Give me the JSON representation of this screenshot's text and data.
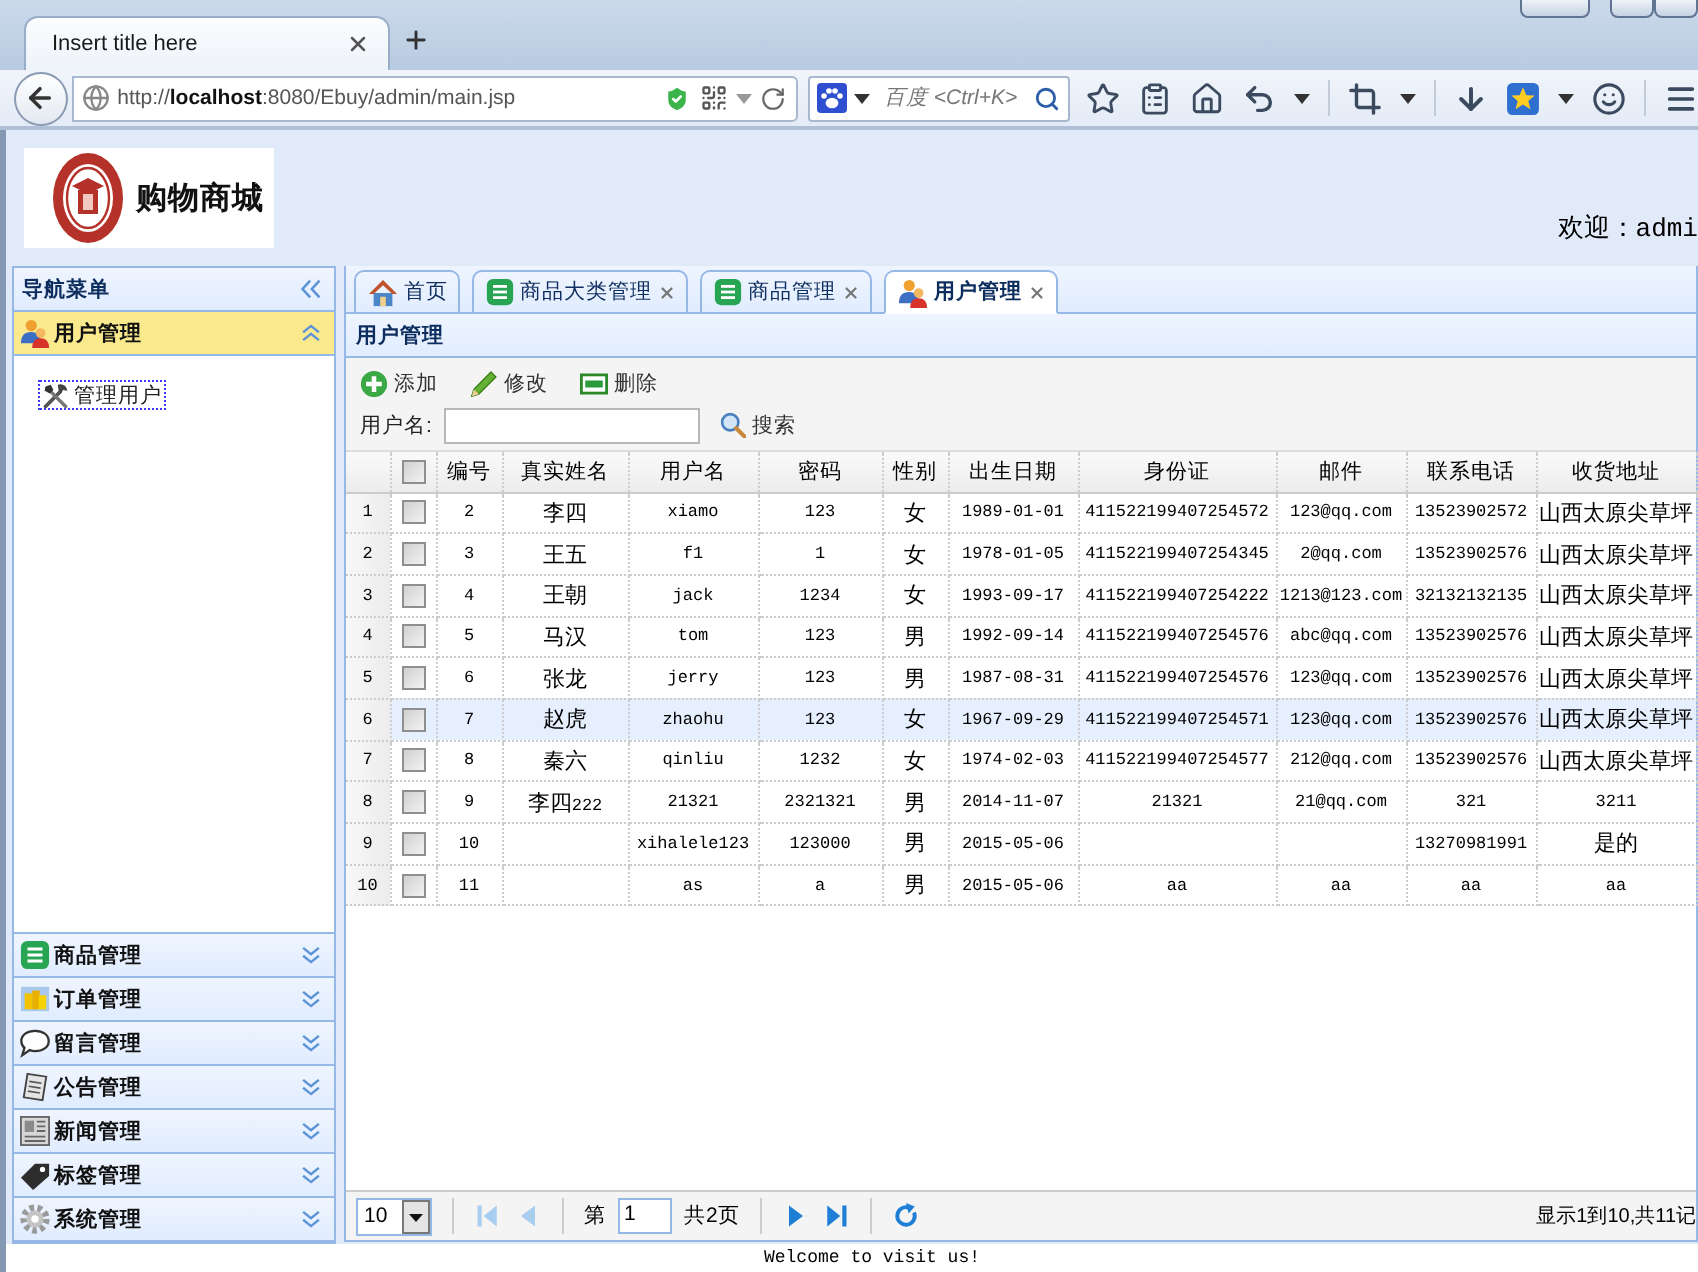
{
  "browser": {
    "tab_title": "Insert title here",
    "url": "http://**localhost**:8080/Ebuy/admin/main.jsp",
    "search_placeholder": "百度 <Ctrl+K>"
  },
  "header": {
    "logo_text": "购物商城",
    "welcome": "欢迎：admi"
  },
  "sidebar": {
    "title": "导航菜单",
    "sections": [
      {
        "kind": "user",
        "label": "用户管理",
        "expanded": true,
        "items": [
          {
            "label": "管理用户",
            "selected": true
          }
        ]
      },
      {
        "kind": "product",
        "label": "商品管理",
        "expanded": false
      },
      {
        "kind": "order",
        "label": "订单管理",
        "expanded": false
      },
      {
        "kind": "message",
        "label": "留言管理",
        "expanded": false
      },
      {
        "kind": "notice",
        "label": "公告管理",
        "expanded": false
      },
      {
        "kind": "news",
        "label": "新闻管理",
        "expanded": false
      },
      {
        "kind": "tag",
        "label": "标签管理",
        "expanded": false
      },
      {
        "kind": "system",
        "label": "系统管理",
        "expanded": false
      }
    ]
  },
  "tabs": [
    {
      "kind": "home",
      "label": "首页",
      "closable": false,
      "selected": false
    },
    {
      "kind": "product",
      "label": "商品大类管理",
      "closable": true,
      "selected": false
    },
    {
      "kind": "product",
      "label": "商品管理",
      "closable": true,
      "selected": false
    },
    {
      "kind": "user",
      "label": "用户管理",
      "closable": true,
      "selected": true
    }
  ],
  "panel": {
    "title": "用户管理"
  },
  "toolbar": [
    {
      "kind": "add",
      "label": "添加"
    },
    {
      "kind": "edit",
      "label": "修改"
    },
    {
      "kind": "delete",
      "label": "删除"
    }
  ],
  "search": {
    "label": "用户名:",
    "button": "搜索"
  },
  "table": {
    "header_checked": false,
    "columns": [
      "编号",
      "真实姓名",
      "用户名",
      "密码",
      "性别",
      "出生日期",
      "身份证",
      "邮件",
      "联系电话",
      "收货地址"
    ],
    "rows": [
      {
        "number": "1",
        "checked": false,
        "highlighted": false,
        "cells": [
          "2",
          "李四",
          "xiamo",
          "123",
          "女",
          "1989-01-01",
          "411522199407254572",
          "123@qq.com",
          "13523902572",
          "山西太原尖草坪"
        ]
      },
      {
        "number": "2",
        "checked": false,
        "highlighted": false,
        "cells": [
          "3",
          "王五",
          "f1",
          "1",
          "女",
          "1978-01-05",
          "411522199407254345",
          "2@qq.com",
          "13523902576",
          "山西太原尖草坪"
        ]
      },
      {
        "number": "3",
        "checked": false,
        "highlighted": false,
        "cells": [
          "4",
          "王朝",
          "jack",
          "1234",
          "女",
          "1993-09-17",
          "411522199407254222",
          "1213@123.com",
          "32132132135",
          "山西太原尖草坪"
        ]
      },
      {
        "number": "4",
        "checked": false,
        "highlighted": false,
        "cells": [
          "5",
          "马汉",
          "tom",
          "123",
          "男",
          "1992-09-14",
          "411522199407254576",
          "abc@qq.com",
          "13523902576",
          "山西太原尖草坪"
        ]
      },
      {
        "number": "5",
        "checked": false,
        "highlighted": false,
        "cells": [
          "6",
          "张龙",
          "jerry",
          "123",
          "男",
          "1987-08-31",
          "411522199407254576",
          "123@qq.com",
          "13523902576",
          "山西太原尖草坪"
        ]
      },
      {
        "number": "6",
        "checked": false,
        "highlighted": true,
        "cells": [
          "7",
          "赵虎",
          "zhaohu",
          "123",
          "女",
          "1967-09-29",
          "411522199407254571",
          "123@qq.com",
          "13523902576",
          "山西太原尖草坪"
        ]
      },
      {
        "number": "7",
        "checked": false,
        "highlighted": false,
        "cells": [
          "8",
          "秦六",
          "qinliu",
          "1232",
          "女",
          "1974-02-03",
          "411522199407254577",
          "212@qq.com",
          "13523902576",
          "山西太原尖草坪"
        ]
      },
      {
        "number": "8",
        "checked": false,
        "highlighted": false,
        "cells": [
          "9",
          "李四222",
          "21321",
          "2321321",
          "男",
          "2014-11-07",
          "21321",
          "21@qq.com",
          "321",
          "3211"
        ]
      },
      {
        "number": "9",
        "checked": false,
        "highlighted": false,
        "cells": [
          "10",
          null,
          "xihalele123",
          "123000",
          "男",
          "2015-05-06",
          null,
          null,
          "13270981991",
          "是的"
        ]
      },
      {
        "number": "10",
        "checked": false,
        "highlighted": false,
        "cells": [
          "11",
          null,
          "as",
          "a",
          "男",
          "2015-05-06",
          "aa",
          "aa",
          "aa",
          "aa"
        ]
      }
    ]
  },
  "pager": {
    "page_size": "10",
    "page_label": "第",
    "page": "1",
    "pages_label": "共2页",
    "summary": "显示1到10,共11记",
    "buttons": [
      {
        "kind": "first",
        "disabled": true
      },
      {
        "kind": "prev",
        "disabled": true
      },
      {
        "kind": "next",
        "disabled": false
      },
      {
        "kind": "last",
        "disabled": false
      },
      {
        "kind": "refresh",
        "disabled": false
      }
    ]
  },
  "footer": "Welcome to visit us!"
}
